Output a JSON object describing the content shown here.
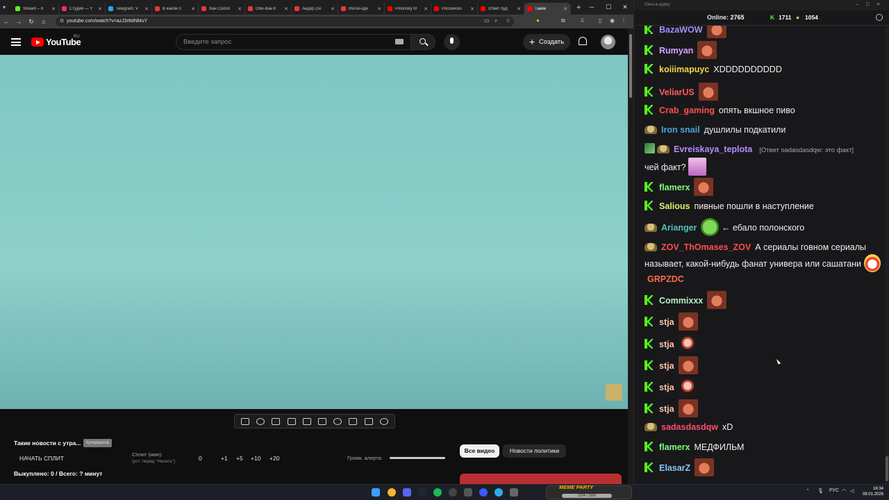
{
  "browser": {
    "tabs": [
      {
        "label": "Stream – K",
        "color": "#53fc18"
      },
      {
        "label": "Студия — Y",
        "color": "#ff2d55"
      },
      {
        "label": "Telegram: V",
        "color": "#2aabee"
      },
      {
        "label": "В каком п",
        "color": "#e53935"
      },
      {
        "label": "Хан Солоп",
        "color": "#e53935"
      },
      {
        "label": "Оби-Ван К",
        "color": "#e53935"
      },
      {
        "label": "Андор (се",
        "color": "#e53935"
      },
      {
        "label": "Изгой-оди",
        "color": "#e53935"
      },
      {
        "label": "Polonsky M",
        "color": "#ff0000"
      },
      {
        "label": "Российско",
        "color": "#ff0000"
      },
      {
        "label": "Ответ буд",
        "color": "#ff0000"
      },
      {
        "label": "Такие",
        "color": "#ff0000",
        "active": true
      }
    ],
    "url": "youtube.com/watch?v=azJ3r8dNMuY"
  },
  "youtube": {
    "logo": "YouTube",
    "logo_region": "RU",
    "search_placeholder": "Введите запрос",
    "create_label": "Создать"
  },
  "below_video": {
    "news_title": "Такие новости с утра...",
    "news_tag": "Купервалов",
    "start_split": "НАЧАТЬ СПЛИТ",
    "split_label": "Сплит (мин):",
    "split_sub": "(уст. перед \"Начать\")",
    "split_values": [
      "0",
      "+1",
      "+5",
      "+10",
      "+20"
    ],
    "volume_label": "Громк. алерта:",
    "chip_all": "Все видео",
    "chip_news": "Новости политики",
    "bought": "Выкуплено: 0 / Всего: ? минут"
  },
  "chat": {
    "window_title": "Окно-в-дурку",
    "online_label": "Online:",
    "online_count": "2765",
    "stat_k": "1711",
    "stat_sub": "1054",
    "messages": [
      {
        "user": "BazaWOW",
        "color": "#a78bfa",
        "badge": "k",
        "text": "",
        "emote": "face"
      },
      {
        "user": "Rumyan",
        "color": "#d6a3ff",
        "badge": "k",
        "text": "",
        "emote": "face"
      },
      {
        "user": "koiiimapuyc",
        "color": "#f5d742",
        "badge": "k",
        "text": "XDDDDDDDDDD",
        "emote": ""
      },
      {
        "user": "VeliarUS",
        "color": "#ff5a5a",
        "badge": "k",
        "text": "",
        "emote": "face"
      },
      {
        "user": "Crab_gaming",
        "color": "#ff4d4d",
        "badge": "k",
        "text": "опять вкшное пиво",
        "emote": ""
      },
      {
        "user": "Iron snail",
        "color": "#4aa3df",
        "badge": "sub",
        "text": "душлилы подкатили",
        "emote": ""
      },
      {
        "user": "Evreiskaya_teplota",
        "color": "#b58cff",
        "badge": "pen",
        "reply": "[Ответ sadasdasdqw: это факт]",
        "text": "чей факт?",
        "emote": "pink"
      },
      {
        "user": "flamerx",
        "color": "#7cfc7c",
        "badge": "k",
        "text": "",
        "emote": "face"
      },
      {
        "user": "Salious",
        "color": "#d7f26b",
        "badge": "k",
        "text": "пивные пошли в наступление",
        "emote": ""
      },
      {
        "user": "Arianger",
        "color": "#4fc3b6",
        "badge": "sub",
        "text": "← ебало полонского",
        "emote": "green"
      },
      {
        "user": "ZOV_ThOmases_ZOV",
        "color": "#ff4d4d",
        "badge": "sub",
        "text": "А сериалы говном сериалы называет, какой-нибудь фанат универа или сашатани",
        "emote": "clown",
        "mention": "GRPZDC"
      },
      {
        "user": "Commixxx",
        "color": "#b8f0c0",
        "badge": "k",
        "text": "",
        "emote": "face"
      },
      {
        "user": "stja",
        "color": "#ffc6a8",
        "badge": "k",
        "text": "",
        "emote": "face"
      },
      {
        "user": "stja",
        "color": "#ffc6a8",
        "badge": "k",
        "text": "",
        "emote": "old"
      },
      {
        "user": "stja",
        "color": "#ffc6a8",
        "badge": "k",
        "text": "",
        "emote": "face"
      },
      {
        "user": "stja",
        "color": "#ffc6a8",
        "badge": "k",
        "text": "",
        "emote": "old"
      },
      {
        "user": "stja",
        "color": "#ffc6a8",
        "badge": "k",
        "text": "",
        "emote": "face"
      },
      {
        "user": "sadasdasdqw",
        "color": "#ff4d6d",
        "badge": "sub",
        "text": "xD",
        "emote": ""
      },
      {
        "user": "flamerx",
        "color": "#7cfc7c",
        "badge": "k",
        "text": "МЕДФИЛЬМ",
        "emote": ""
      },
      {
        "user": "ElasarZ",
        "color": "#88c7ff",
        "badge": "k",
        "text": "",
        "emote": "face"
      }
    ]
  },
  "taskbar": {
    "widget_title": "MEME PARTY",
    "widget_progress": "1204 / 1500",
    "lang": "РУС",
    "time": "16:34",
    "date": "09.01.2026"
  },
  "colors": {
    "kick_green": "#53fc18",
    "youtube_red": "#ff0000"
  }
}
